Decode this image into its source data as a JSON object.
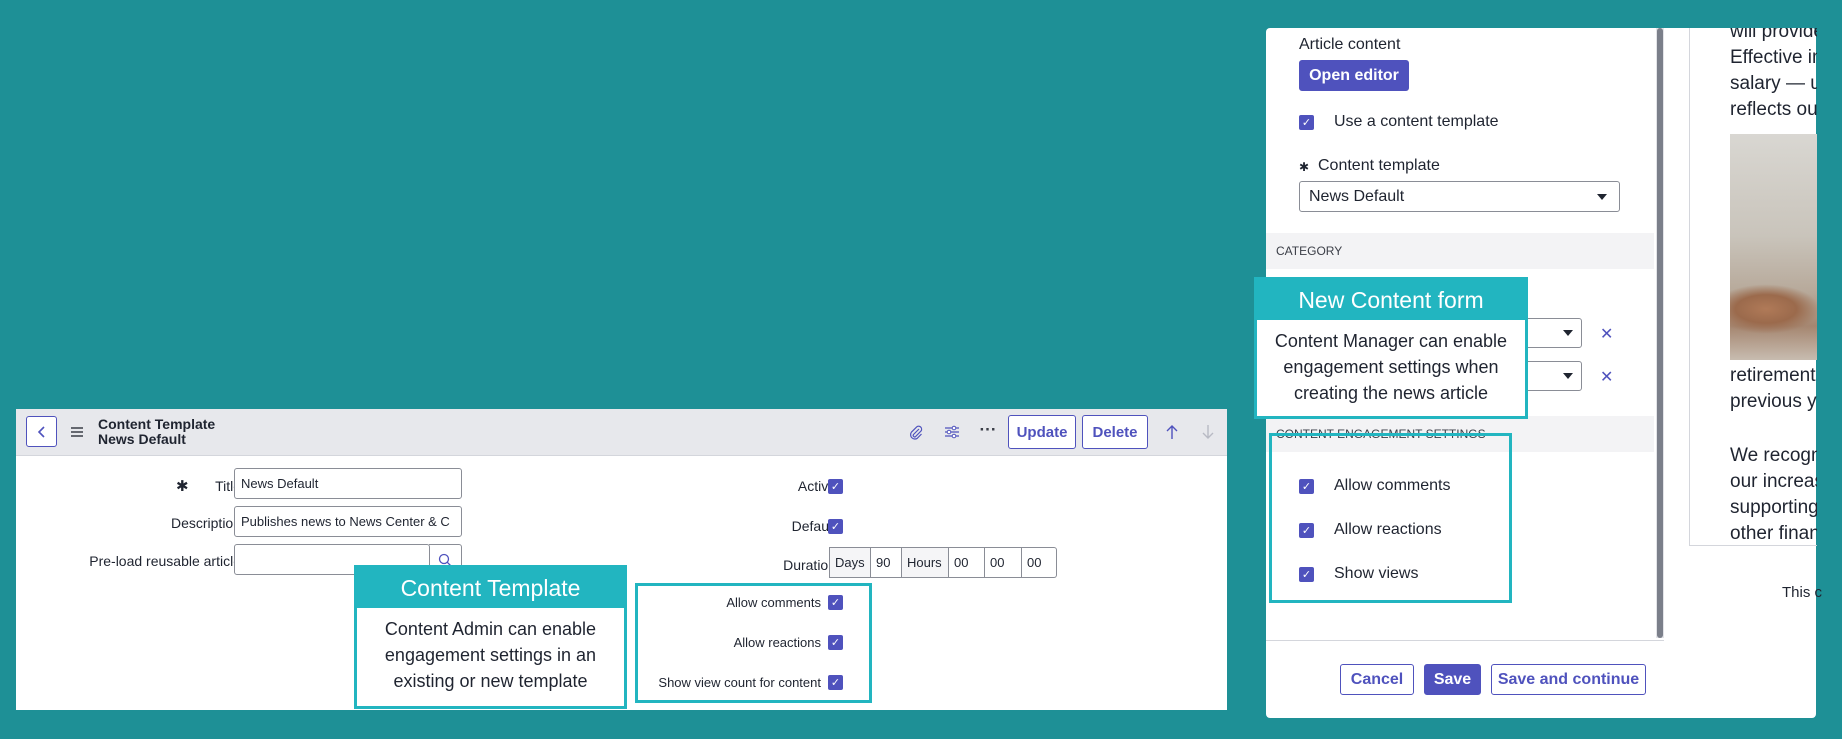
{
  "left_form": {
    "header": {
      "title_line1": "Content Template",
      "title_line2": "News Default",
      "update_label": "Update",
      "delete_label": "Delete"
    },
    "fields": {
      "title_label": "Title",
      "title_value": "News Default",
      "description_label": "Description",
      "description_value": "Publishes news to News Center & C",
      "preload_label": "Pre-load reusable article",
      "preload_value": "",
      "active_label": "Active",
      "default_label": "Default",
      "duration_label": "Duration",
      "duration_days_label": "Days",
      "duration_days_value": "90",
      "duration_hours_label": "Hours",
      "duration_hours_value": "00",
      "duration_minutes_value": "00",
      "duration_seconds_value": "00",
      "allow_comments_label": "Allow comments",
      "allow_reactions_label": "Allow reactions",
      "show_view_count_label": "Show view count for content"
    },
    "checkboxes": {
      "active": true,
      "default": true,
      "allow_comments": true,
      "allow_reactions": true,
      "show_view_count": true
    }
  },
  "callouts": {
    "template_title": "Content Template",
    "template_text": [
      "Content Admin can enable",
      "engagement settings in an",
      "existing or new template"
    ],
    "form_title": "New Content form",
    "form_text": [
      "Content Manager can enable",
      "engagement settings when",
      "creating the news article"
    ]
  },
  "right_panel": {
    "article_content_label": "Article content",
    "open_editor_label": "Open editor",
    "use_template_label": "Use a content template",
    "content_template_label": "Content template",
    "content_template_value": "News Default",
    "category_section": "CATEGORY",
    "engagement_section": "CONTENT ENGAGEMENT SETTINGS",
    "allow_comments_label": "Allow comments",
    "allow_reactions_label": "Allow reactions",
    "show_views_label": "Show views",
    "cancel_label": "Cancel",
    "save_label": "Save",
    "save_continue_label": "Save and continue",
    "checkboxes": {
      "use_template": true,
      "allow_comments": true,
      "allow_reactions": true,
      "show_views": true
    }
  },
  "article_preview": {
    "lines_top": [
      "will provide",
      "Effective im",
      "salary — up",
      "reflects our"
    ],
    "lines_mid": [
      "retirement s",
      "previous ye"
    ],
    "lines_bottom": [
      "We recogni",
      "our increase",
      "supporting",
      "other financ"
    ],
    "footer_text": "This c"
  },
  "colors": {
    "background": "#1e9096",
    "accent": "#4f52bd",
    "callout": "#22b5c0"
  },
  "icons": [
    "back-chevron-icon",
    "hamburger-menu-icon",
    "paperclip-icon",
    "sliders-icon",
    "more-icon",
    "arrow-up-icon",
    "arrow-down-icon",
    "search-icon",
    "required-asterisk-icon",
    "checkmark-icon",
    "dropdown-caret-icon",
    "remove-x-icon"
  ]
}
